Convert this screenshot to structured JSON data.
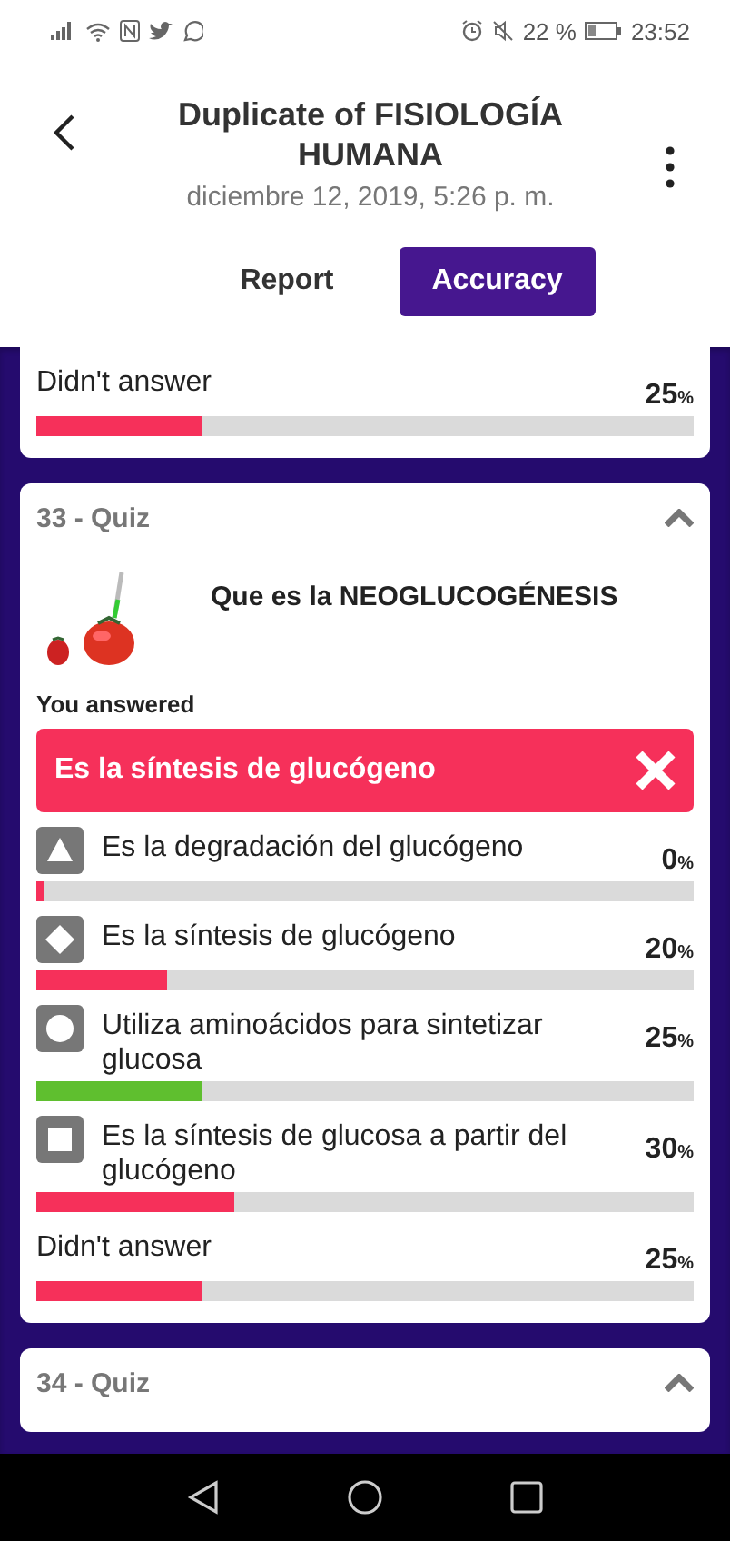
{
  "status_bar": {
    "battery": "22 %",
    "time": "23:52"
  },
  "header": {
    "title": "Duplicate of FISIOLOGÍA HUMANA",
    "date": "diciembre 12, 2019, 5:26 p. m."
  },
  "tabs": [
    {
      "label": "Report",
      "selected": false
    },
    {
      "label": "Accuracy",
      "selected": true
    }
  ],
  "cards": [
    {
      "partial": true,
      "answers": [
        {
          "kind": "none",
          "text": "Didn't answer",
          "value": "25",
          "unit": "%",
          "level": 0.25,
          "correct": false
        }
      ]
    },
    {
      "title": "33 - Quiz",
      "expanded": true,
      "question": "Que es la NEOGLUCOGÉNESIS",
      "has_picture": true,
      "you_answered_label": "You answered",
      "your_answer": "Es la síntesis de glucógeno",
      "your_answer_correct": false,
      "answers": [
        {
          "kind": "triangle",
          "text": "Es la degradación del glucógeno",
          "value": "0",
          "unit": "%",
          "level": 0.01,
          "correct": false
        },
        {
          "kind": "diamond",
          "text": "Es la síntesis de glucógeno",
          "value": "20",
          "unit": "%",
          "level": 0.2,
          "correct": false
        },
        {
          "kind": "circle",
          "text": "Utiliza aminoácidos para sintetizar glucosa",
          "value": "25",
          "unit": "%",
          "level": 0.25,
          "correct": true
        },
        {
          "kind": "square",
          "text": "Es la síntesis de glucosa a partir del glucógeno",
          "value": "30",
          "unit": "%",
          "level": 0.3,
          "correct": false
        },
        {
          "kind": "none",
          "text": "Didn't answer",
          "value": "25",
          "unit": "%",
          "level": 0.25,
          "correct": false
        }
      ]
    },
    {
      "title": "34 - Quiz",
      "expanded": true
    }
  ]
}
